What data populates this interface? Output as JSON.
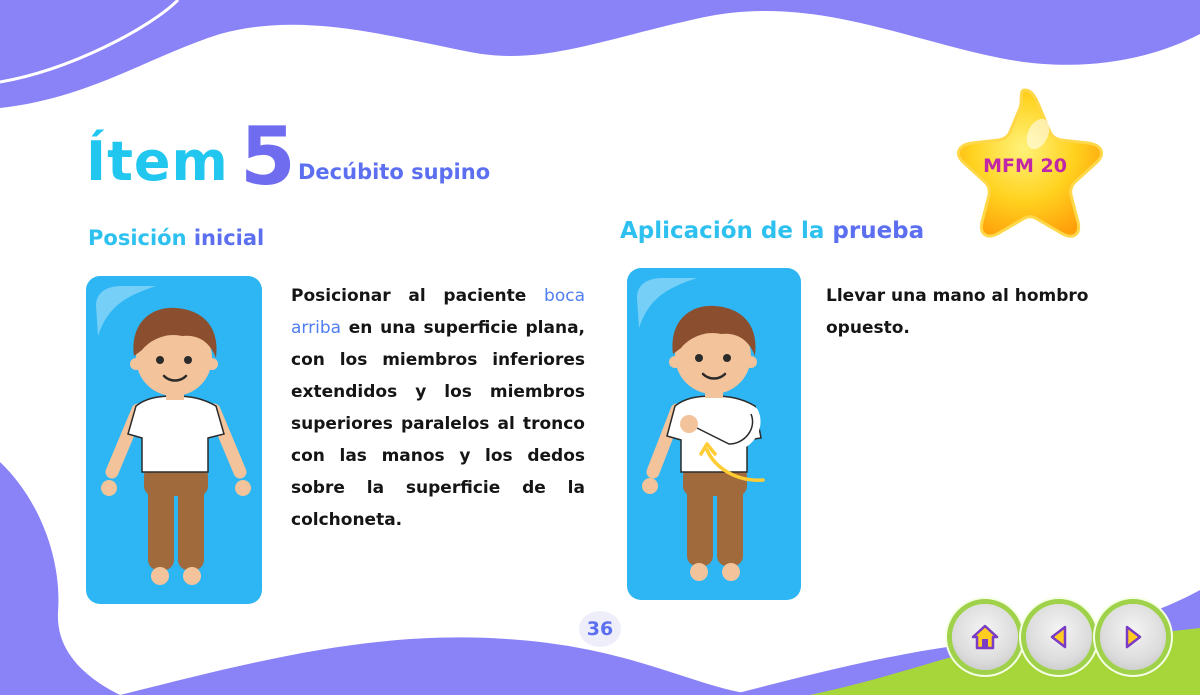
{
  "header": {
    "item_word": "Ítem",
    "item_number": "5",
    "position_name": "Decúbito supino"
  },
  "badge": {
    "label": "MFM 20",
    "star_color": "#ffc21a"
  },
  "left_section": {
    "title_part1": "Posición",
    "title_part2": "inicial",
    "text_part1": "Posicionar al paciente",
    "text_highlight": "boca arriba",
    "text_part2": "en una superficie plana, con los miembros inferiores extendidos y los miembros superiores paralelos al tronco con las manos y los dedos sobre la superficie de la colchoneta."
  },
  "right_section": {
    "title_part1": "Aplicación de la",
    "title_part2": "prueba",
    "text": "Llevar una mano al hombro opuesto."
  },
  "footer": {
    "page_number": "36"
  },
  "nav": {
    "home_icon": "home-icon",
    "prev_icon": "triangle-left-icon",
    "next_icon": "triangle-right-icon"
  },
  "colors": {
    "primary_purple": "#8a82f7",
    "accent_cyan": "#22c7f0",
    "accent_blue": "#5b6ff0",
    "card_blue": "#2db6f3",
    "lime": "#a6d63a"
  }
}
